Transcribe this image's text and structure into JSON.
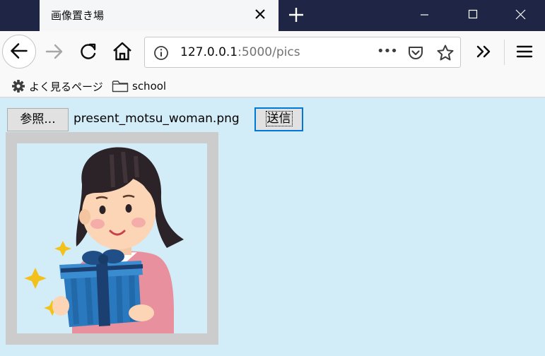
{
  "browser": {
    "tab": {
      "title": "画像置き場"
    },
    "url": {
      "host": "127.0.0.1",
      "path": ":5000/pics"
    },
    "more_label": "•••"
  },
  "bookmarks": [
    {
      "label": "よく見るページ",
      "icon": "gear-icon"
    },
    {
      "label": "school",
      "icon": "folder-icon"
    }
  ],
  "page": {
    "browse_button": "参照...",
    "selected_file": "present_motsu_woman.png",
    "submit_button": "送信"
  },
  "colors": {
    "tabbar": "#1f2545",
    "page_background": "#d3edf8",
    "focus_border": "#0078d7"
  }
}
